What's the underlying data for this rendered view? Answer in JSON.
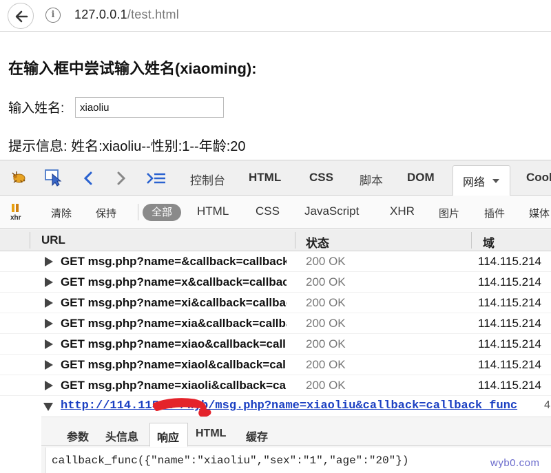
{
  "browser": {
    "url_host": "127.0.0.1",
    "url_path": "/test.html"
  },
  "page": {
    "title": "在输入框中尝试输入姓名(xiaoming):",
    "input_label": "输入姓名:",
    "input_value": "xiaoliu",
    "hint": "提示信息: 姓名:xiaoliu--性别:1--年龄:20"
  },
  "devtools": {
    "tabs": [
      "控制台",
      "HTML",
      "CSS",
      "脚本",
      "DOM",
      "网络",
      "Cool"
    ],
    "filters": {
      "clear": "清除",
      "persist": "保持",
      "all": "全部",
      "types": [
        "HTML",
        "CSS",
        "JavaScript",
        "XHR",
        "图片",
        "插件",
        "媒体"
      ]
    },
    "columns": {
      "url": "URL",
      "status": "状态",
      "domain": "域"
    },
    "requests": [
      {
        "label": "GET msg.php?name=&callback=callback_func",
        "status": "200 OK",
        "domain": "114.115.214"
      },
      {
        "label": "GET msg.php?name=x&callback=callback_func",
        "status": "200 OK",
        "domain": "114.115.214"
      },
      {
        "label": "GET msg.php?name=xi&callback=callback_func",
        "status": "200 OK",
        "domain": "114.115.214"
      },
      {
        "label": "GET msg.php?name=xia&callback=callback_func",
        "status": "200 OK",
        "domain": "114.115.214"
      },
      {
        "label": "GET msg.php?name=xiao&callback=callback_func",
        "status": "200 OK",
        "domain": "114.115.214"
      },
      {
        "label": "GET msg.php?name=xiaol&callback=callback_func",
        "status": "200 OK",
        "domain": "114.115.214"
      },
      {
        "label": "GET msg.php?name=xiaoli&callback=callback_func",
        "status": "200 OK",
        "domain": "114.115.214"
      }
    ],
    "expanded": {
      "url": "http://114.115.2     /wyb/msg.php?name=xiaoliu&callback=callback_func",
      "trail": "4",
      "tabs": [
        "参数",
        "头信息",
        "响应",
        "HTML",
        "缓存"
      ],
      "response": "callback_func({\"name\":\"xiaoliu\",\"sex\":\"1\",\"age\":\"20\"})"
    }
  },
  "watermark": "wyb0.com"
}
